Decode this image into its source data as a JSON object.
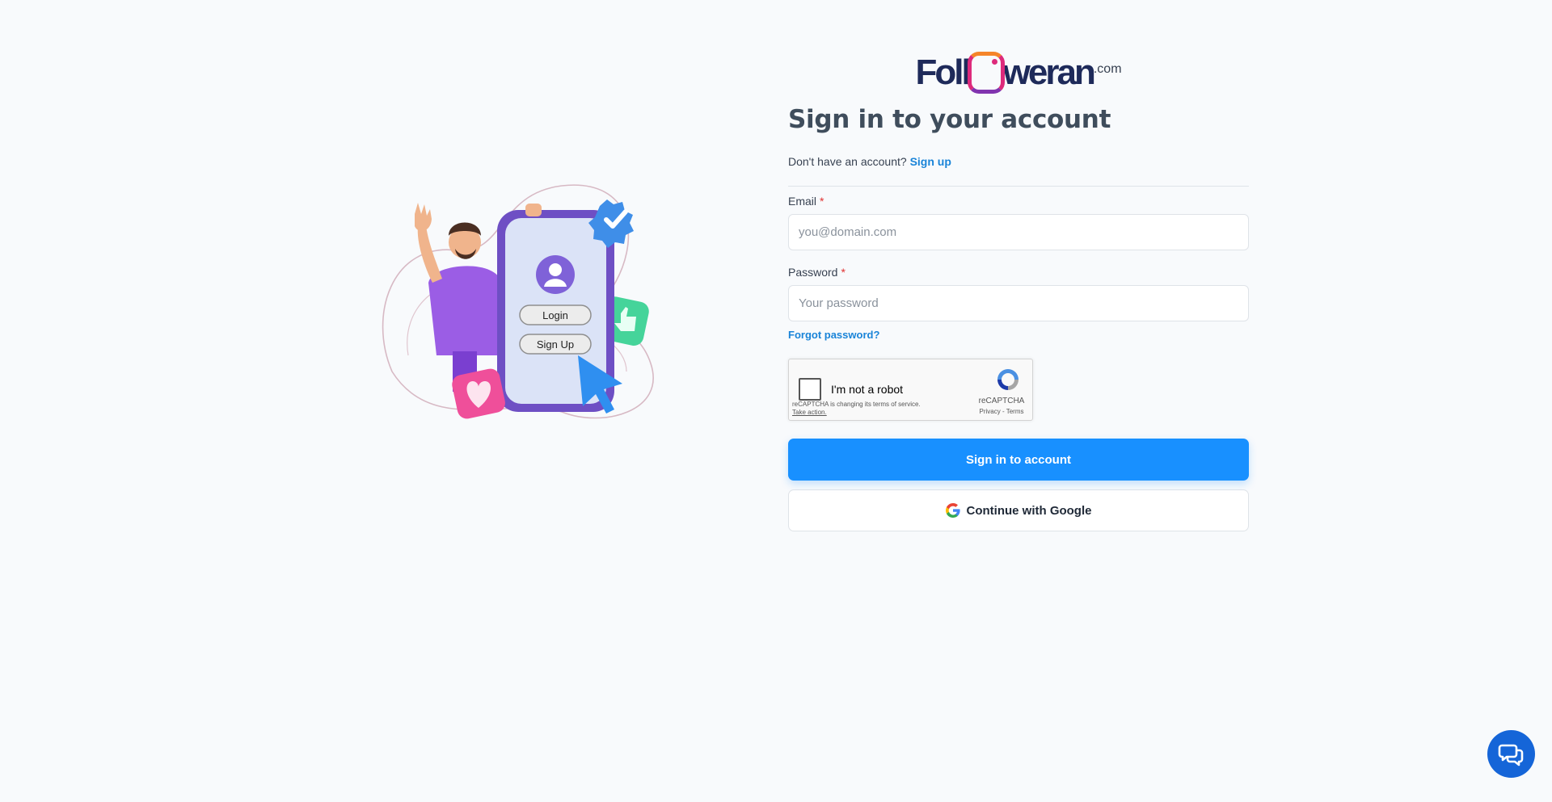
{
  "brand": {
    "logo_text_left": "Foll",
    "logo_text_right": "weran",
    "logo_suffix": ".com"
  },
  "illustration": {
    "login_label": "Login",
    "signup_label": "Sign Up"
  },
  "form": {
    "title": "Sign in to your account",
    "no_account_text": "Don't have an account?",
    "signup_link": "Sign up",
    "email_label": "Email",
    "email_placeholder": "you@domain.com",
    "password_label": "Password",
    "password_placeholder": "Your password",
    "required_mark": "*",
    "forgot_password": "Forgot password?",
    "submit_label": "Sign in to account",
    "google_label": "Continue with Google"
  },
  "recaptcha": {
    "label": "I'm not a robot",
    "notice": "reCAPTCHA is changing its terms of service.",
    "take_action": "Take action.",
    "brand": "reCAPTCHA",
    "links": "Privacy - Terms"
  },
  "colors": {
    "primary": "#1890ff",
    "link": "#1a84d8",
    "required": "#e03131",
    "chat": "#1565d8"
  },
  "icons": {
    "google": "google-icon",
    "recaptcha": "recaptcha-icon",
    "chat": "chat-icon"
  }
}
